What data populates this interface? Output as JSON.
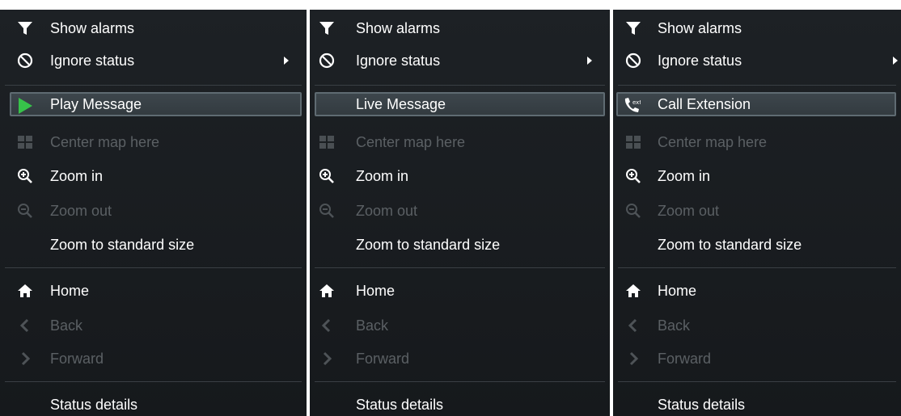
{
  "menus": [
    {
      "items": {
        "show_alarms": "Show alarms",
        "ignore_status": "Ignore status",
        "action": "Play Message",
        "center_map": "Center map here",
        "zoom_in": "Zoom in",
        "zoom_out": "Zoom out",
        "zoom_standard": "Zoom to standard size",
        "home": "Home",
        "back": "Back",
        "forward": "Forward",
        "status_details": "Status details"
      },
      "action_icon": "play-icon"
    },
    {
      "items": {
        "show_alarms": "Show alarms",
        "ignore_status": "Ignore status",
        "action": "Live Message",
        "center_map": "Center map here",
        "zoom_in": "Zoom in",
        "zoom_out": "Zoom out",
        "zoom_standard": "Zoom to standard size",
        "home": "Home",
        "back": "Back",
        "forward": "Forward",
        "status_details": "Status details"
      },
      "action_icon": ""
    },
    {
      "items": {
        "show_alarms": "Show alarms",
        "ignore_status": "Ignore status",
        "action": "Call Extension",
        "center_map": "Center map here",
        "zoom_in": "Zoom in",
        "zoom_out": "Zoom out",
        "zoom_standard": "Zoom to standard size",
        "home": "Home",
        "back": "Back",
        "forward": "Forward",
        "status_details": "Status details"
      },
      "action_icon": "phone-call-icon"
    }
  ],
  "colors": {
    "background": "#1b1f22",
    "text": "#ffffff",
    "disabled_text": "#5b6064",
    "highlight": "#3a4247",
    "play_green": "#37c24a"
  }
}
